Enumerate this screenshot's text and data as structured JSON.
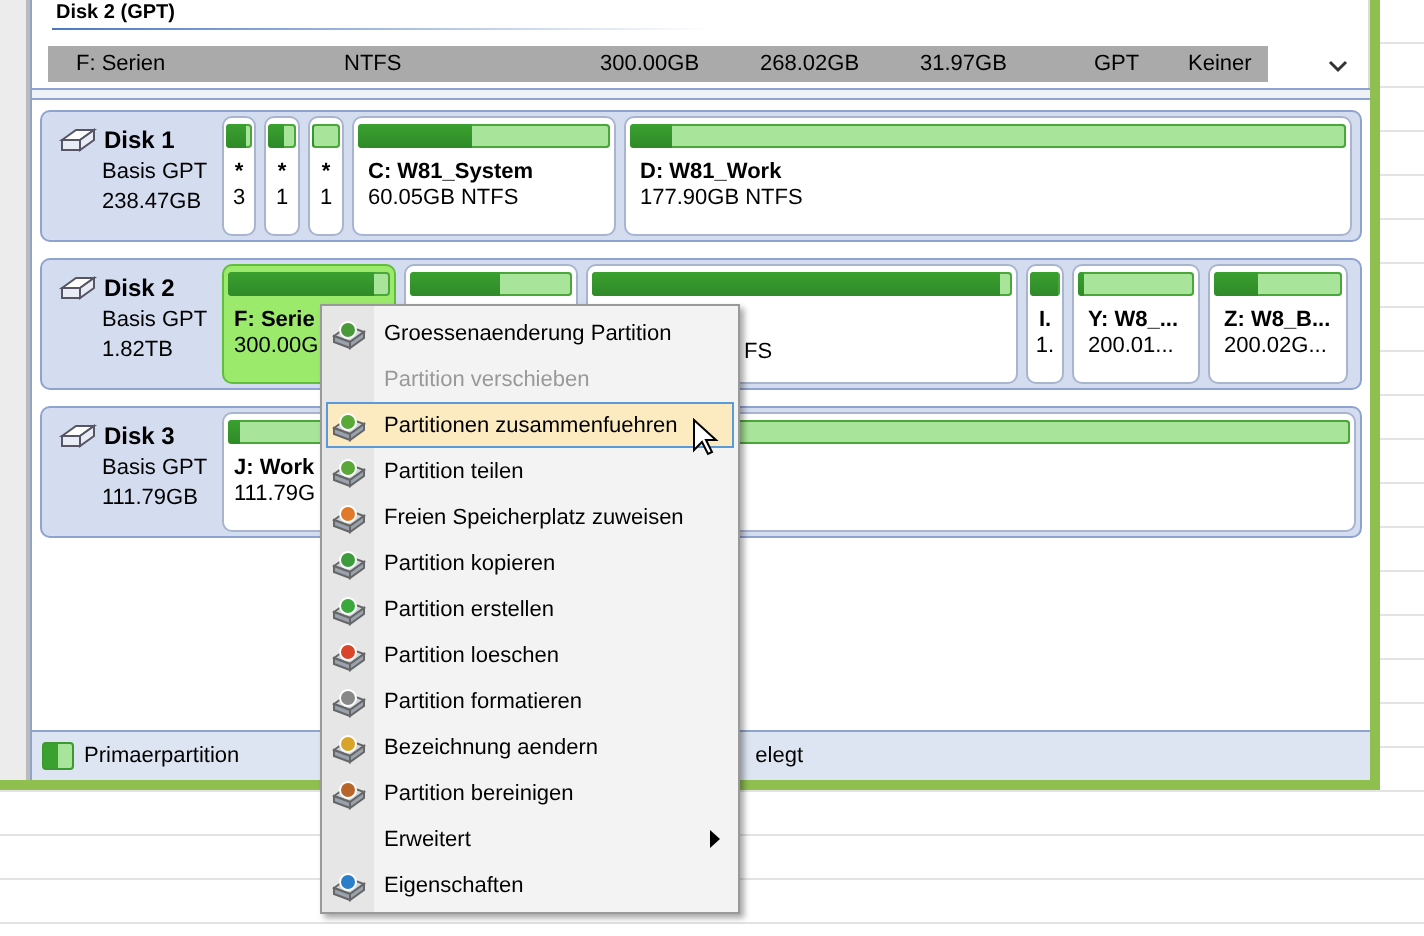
{
  "list_header": {
    "title": "Disk 2 (GPT)"
  },
  "list_row": {
    "cells": [
      "F: Serien",
      "NTFS",
      "300.00GB",
      "268.02GB",
      "31.97GB",
      "GPT",
      "Keiner"
    ],
    "selected": true
  },
  "disks": [
    {
      "name": "Disk 1",
      "type": "Basis GPT",
      "size": "238.47GB",
      "partitions": [
        {
          "kind": "small",
          "label": "*",
          "detail": "3",
          "level": 0.8,
          "selected": false
        },
        {
          "kind": "small",
          "label": "*",
          "detail": "1",
          "level": 0.6,
          "selected": false
        },
        {
          "kind": "small",
          "label": "*",
          "detail": "1",
          "level": 0.1,
          "selected": false
        },
        {
          "kind": "normal",
          "label": "C: W81_System",
          "detail": "60.05GB NTFS",
          "level": 0.45,
          "selected": false
        },
        {
          "kind": "normal",
          "label": "D: W81_Work",
          "detail": "177.90GB NTFS",
          "level": 0.06,
          "selected": false
        }
      ]
    },
    {
      "name": "Disk 2",
      "type": "Basis GPT",
      "size": "1.82TB",
      "partitions": [
        {
          "kind": "normal",
          "label": "F: Serie",
          "detail": "300.00G",
          "level": 0.9,
          "selected": true
        },
        {
          "kind": "normal",
          "level": 0.55,
          "selected": false
        },
        {
          "kind": "partial",
          "detail": "FS",
          "level": 0.97,
          "selected": false
        },
        {
          "kind": "small",
          "label": "I.",
          "detail": "1.",
          "level": 0.95,
          "selected": false
        },
        {
          "kind": "normal",
          "label": "Y: W8_...",
          "detail": "200.01...",
          "level": 0.05,
          "selected": false
        },
        {
          "kind": "normal",
          "label": "Z: W8_B...",
          "detail": "200.02G...",
          "level": 0.35,
          "selected": false
        }
      ]
    },
    {
      "name": "Disk 3",
      "type": "Basis GPT",
      "size": "111.79GB",
      "partitions": [
        {
          "kind": "normal",
          "label": "J: Work",
          "detail": "111.79G",
          "level": 0.01,
          "selected": false
        }
      ]
    }
  ],
  "legend": [
    {
      "kind": "swatch",
      "label": "Primaerpartition"
    },
    {
      "kind": "plain",
      "label": "elegt"
    }
  ],
  "context_menu": {
    "items": [
      {
        "kind": "action",
        "label": "Groessenaenderung Partition",
        "disabled": false,
        "selected": false
      },
      {
        "kind": "plain",
        "label": "Partition verschieben",
        "disabled": true,
        "selected": false
      },
      {
        "kind": "action",
        "label": "Partitionen zusammenfuehren",
        "disabled": false,
        "selected": true
      },
      {
        "kind": "action",
        "label": "Partition teilen",
        "disabled": false,
        "selected": false
      },
      {
        "kind": "action",
        "label": "Freien Speicherplatz zuweisen",
        "disabled": false,
        "selected": false
      },
      {
        "kind": "action",
        "label": "Partition kopieren",
        "disabled": false,
        "selected": false
      },
      {
        "kind": "action",
        "label": "Partition erstellen",
        "disabled": false,
        "selected": false
      },
      {
        "kind": "action",
        "label": "Partition loeschen",
        "disabled": false,
        "selected": false
      },
      {
        "kind": "action",
        "label": "Partition formatieren",
        "disabled": false,
        "selected": false
      },
      {
        "kind": "action",
        "label": "Bezeichnung aendern",
        "disabled": false,
        "selected": false
      },
      {
        "kind": "action",
        "label": "Partition bereinigen",
        "disabled": false,
        "selected": false
      },
      {
        "kind": "submenu",
        "label": "Erweitert",
        "disabled": false,
        "selected": false
      },
      {
        "kind": "action",
        "label": "Eigenschaften",
        "disabled": false,
        "selected": false
      }
    ]
  }
}
